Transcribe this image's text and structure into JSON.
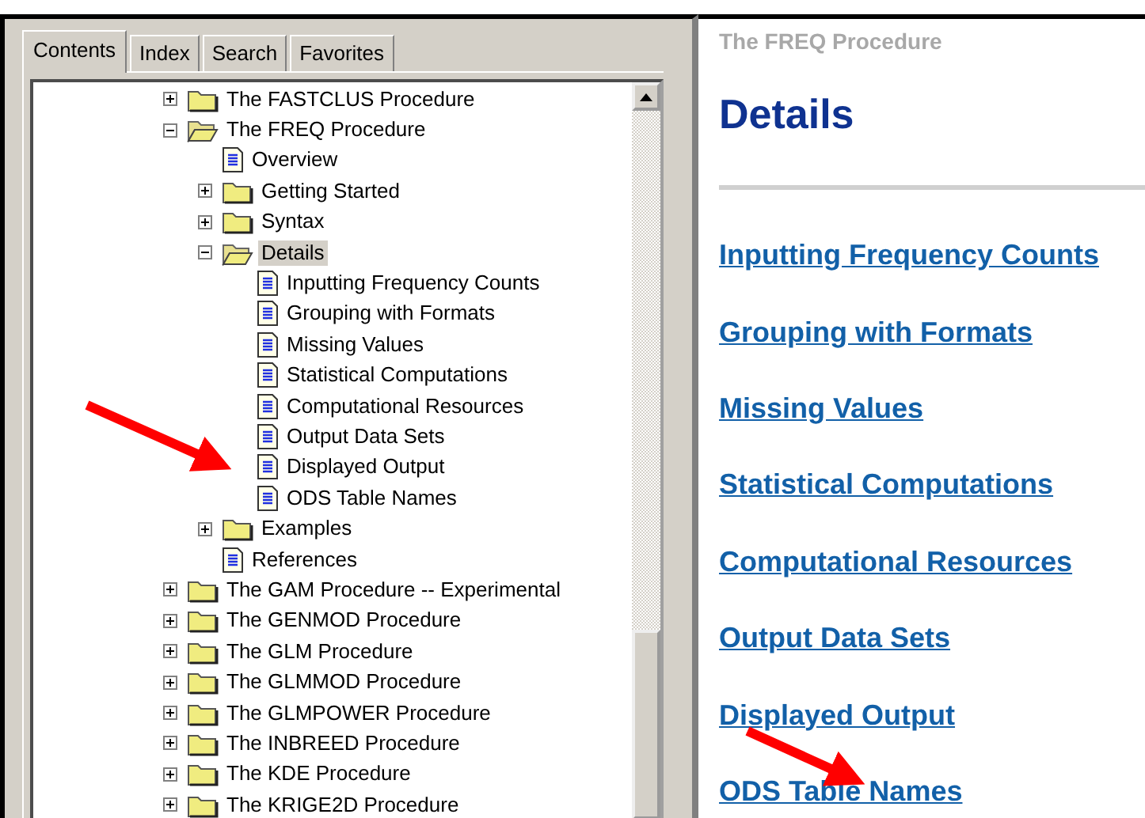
{
  "tabs": [
    {
      "label": "Contents",
      "selected": true
    },
    {
      "label": "Index",
      "selected": false
    },
    {
      "label": "Search",
      "selected": false
    },
    {
      "label": "Favorites",
      "selected": false
    }
  ],
  "tree": [
    {
      "kind": "folder",
      "label": "The FASTCLUS Procedure",
      "expanded": false,
      "selected": false
    },
    {
      "kind": "folder",
      "label": "The FREQ Procedure",
      "expanded": true,
      "selected": false,
      "children": [
        {
          "kind": "doc",
          "label": "Overview",
          "selected": false
        },
        {
          "kind": "folder",
          "label": "Getting Started",
          "expanded": false,
          "selected": false
        },
        {
          "kind": "folder",
          "label": "Syntax",
          "expanded": false,
          "selected": false
        },
        {
          "kind": "folder",
          "label": "Details",
          "expanded": true,
          "selected": true,
          "children": [
            {
              "kind": "doc",
              "label": "Inputting Frequency Counts",
              "selected": false
            },
            {
              "kind": "doc",
              "label": "Grouping with Formats",
              "selected": false
            },
            {
              "kind": "doc",
              "label": "Missing Values",
              "selected": false
            },
            {
              "kind": "doc",
              "label": "Statistical Computations",
              "selected": false
            },
            {
              "kind": "doc",
              "label": "Computational Resources",
              "selected": false
            },
            {
              "kind": "doc",
              "label": "Output Data Sets",
              "selected": false
            },
            {
              "kind": "doc",
              "label": "Displayed Output",
              "selected": false
            },
            {
              "kind": "doc",
              "label": "ODS Table Names",
              "selected": false
            }
          ]
        },
        {
          "kind": "folder",
          "label": "Examples",
          "expanded": false,
          "selected": false
        },
        {
          "kind": "doc",
          "label": "References",
          "selected": false
        }
      ]
    },
    {
      "kind": "folder",
      "label": "The GAM Procedure -- Experimental",
      "expanded": false,
      "selected": false
    },
    {
      "kind": "folder",
      "label": "The GENMOD Procedure",
      "expanded": false,
      "selected": false
    },
    {
      "kind": "folder",
      "label": "The GLM Procedure",
      "expanded": false,
      "selected": false
    },
    {
      "kind": "folder",
      "label": "The GLMMOD Procedure",
      "expanded": false,
      "selected": false
    },
    {
      "kind": "folder",
      "label": "The GLMPOWER Procedure",
      "expanded": false,
      "selected": false
    },
    {
      "kind": "folder",
      "label": "The INBREED Procedure",
      "expanded": false,
      "selected": false
    },
    {
      "kind": "folder",
      "label": "The KDE Procedure",
      "expanded": false,
      "selected": false
    },
    {
      "kind": "folder",
      "label": "The KRIGE2D Procedure",
      "expanded": false,
      "selected": false
    }
  ],
  "content": {
    "breadcrumb": "The FREQ Procedure",
    "heading": "Details",
    "links": [
      "Inputting Frequency Counts",
      "Grouping with Formats",
      "Missing Values",
      "Statistical Computations",
      "Computational Resources",
      "Output Data Sets",
      "Displayed Output",
      "ODS Table Names"
    ]
  }
}
